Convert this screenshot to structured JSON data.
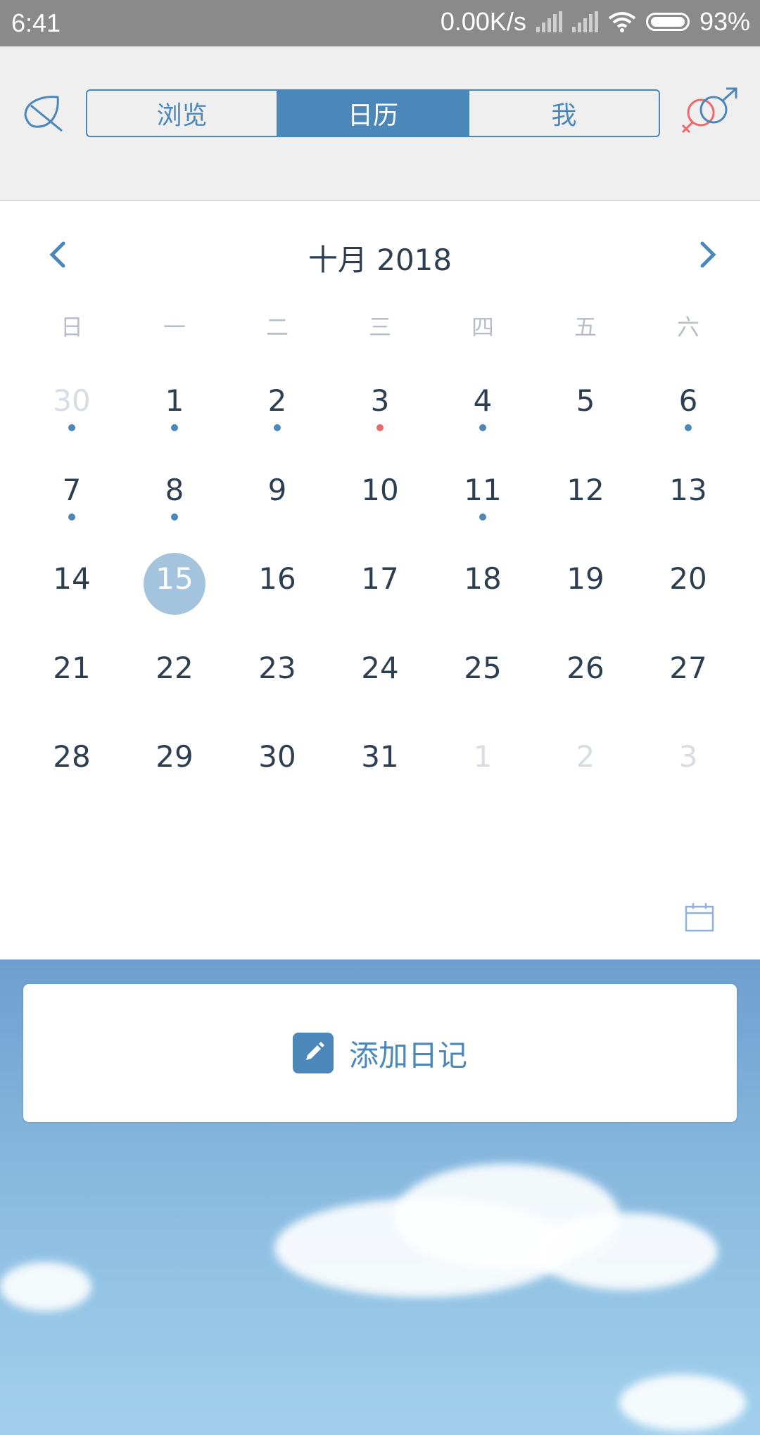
{
  "status": {
    "time": "6:41",
    "speed": "0.00K/s",
    "battery": "93%"
  },
  "tabs": [
    "浏览",
    "日历",
    "我"
  ],
  "active_tab": 1,
  "calendar": {
    "title": "十月 2018",
    "weekdays": [
      "日",
      "一",
      "二",
      "三",
      "四",
      "五",
      "六"
    ],
    "weeks": [
      [
        {
          "d": "30",
          "other": true,
          "dot": "blue"
        },
        {
          "d": "1",
          "dot": "blue"
        },
        {
          "d": "2",
          "dot": "blue"
        },
        {
          "d": "3",
          "dot": "red"
        },
        {
          "d": "4",
          "dot": "blue"
        },
        {
          "d": "5"
        },
        {
          "d": "6",
          "dot": "blue"
        }
      ],
      [
        {
          "d": "7",
          "dot": "blue"
        },
        {
          "d": "8",
          "dot": "blue"
        },
        {
          "d": "9"
        },
        {
          "d": "10"
        },
        {
          "d": "11",
          "dot": "blue"
        },
        {
          "d": "12"
        },
        {
          "d": "13"
        }
      ],
      [
        {
          "d": "14"
        },
        {
          "d": "15",
          "selected": true
        },
        {
          "d": "16"
        },
        {
          "d": "17"
        },
        {
          "d": "18"
        },
        {
          "d": "19"
        },
        {
          "d": "20"
        }
      ],
      [
        {
          "d": "21"
        },
        {
          "d": "22"
        },
        {
          "d": "23"
        },
        {
          "d": "24"
        },
        {
          "d": "25"
        },
        {
          "d": "26"
        },
        {
          "d": "27"
        }
      ],
      [
        {
          "d": "28"
        },
        {
          "d": "29"
        },
        {
          "d": "30"
        },
        {
          "d": "31"
        },
        {
          "d": "1",
          "other": true
        },
        {
          "d": "2",
          "other": true
        },
        {
          "d": "3",
          "other": true
        }
      ]
    ]
  },
  "add_diary": {
    "label": "添加日记",
    "icon": "pencil-icon"
  },
  "colors": {
    "accent": "#4b87b9",
    "selected_day": "#a4c3dc",
    "dot_blue": "#4b87b9",
    "dot_red": "#e96a6a"
  }
}
